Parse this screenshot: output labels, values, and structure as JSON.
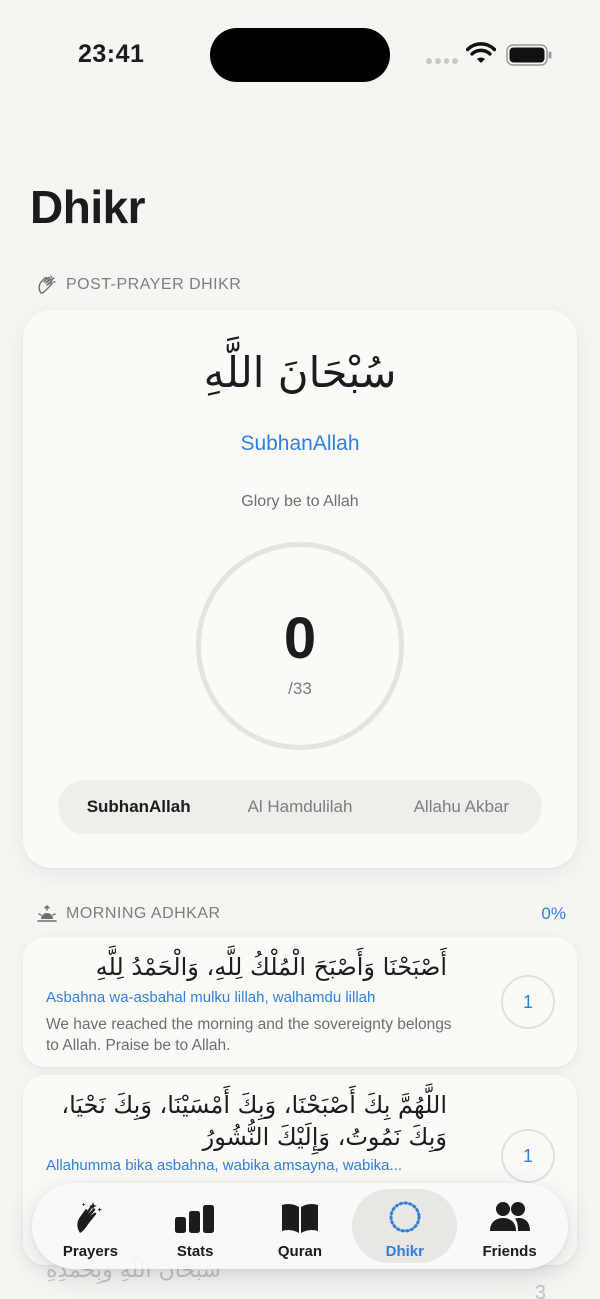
{
  "status_bar": {
    "time": "23:41"
  },
  "page": {
    "title": "Dhikr"
  },
  "post_prayer": {
    "section_label": "POST-PRAYER DHIKR",
    "arabic": "سُبْحَانَ اللَّهِ",
    "transliteration": "SubhanAllah",
    "translation": "Glory be to Allah",
    "count": "0",
    "target": "/33",
    "options": [
      "SubhanAllah",
      "Al Hamdulilah",
      "Allahu Akbar"
    ],
    "selected_option": "SubhanAllah"
  },
  "morning": {
    "section_label": "MORNING ADHKAR",
    "progress": "0%",
    "items": [
      {
        "arabic": "أَصْبَحْنَا وَأَصْبَحَ الْمُلْكُ لِلَّهِ، وَالْحَمْدُ لِلَّهِ",
        "transliteration": "Asbahna wa-asbahal mulku lillah, walhamdu lillah",
        "translation": "We have reached the morning and the sovereignty belongs to Allah. Praise be to Allah.",
        "count": "1"
      },
      {
        "arabic": "اللَّهُمَّ بِكَ أَصْبَحْنَا، وَبِكَ أَمْسَيْنَا، وَبِكَ نَحْيَا، وَبِكَ نَمُوتُ، وَإِلَيْكَ النُّشُورُ",
        "transliteration": "Allahumma bika asbahna, wabika amsayna, wabika...",
        "count": "1"
      },
      {
        "arabic": "سُبْحَانَ اللَّهِ وَبِحَمْدِهِ",
        "count": "3"
      }
    ]
  },
  "tabs": [
    {
      "label": "Prayers",
      "icon": "praying-hands-icon"
    },
    {
      "label": "Stats",
      "icon": "bar-chart-icon"
    },
    {
      "label": "Quran",
      "icon": "open-book-icon"
    },
    {
      "label": "Dhikr",
      "icon": "dotted-circle-icon",
      "active": true
    },
    {
      "label": "Friends",
      "icon": "people-icon"
    }
  ],
  "colors": {
    "accent": "#2f7fdc",
    "background": "#f6f5f2",
    "card": "#fbfaf7"
  }
}
